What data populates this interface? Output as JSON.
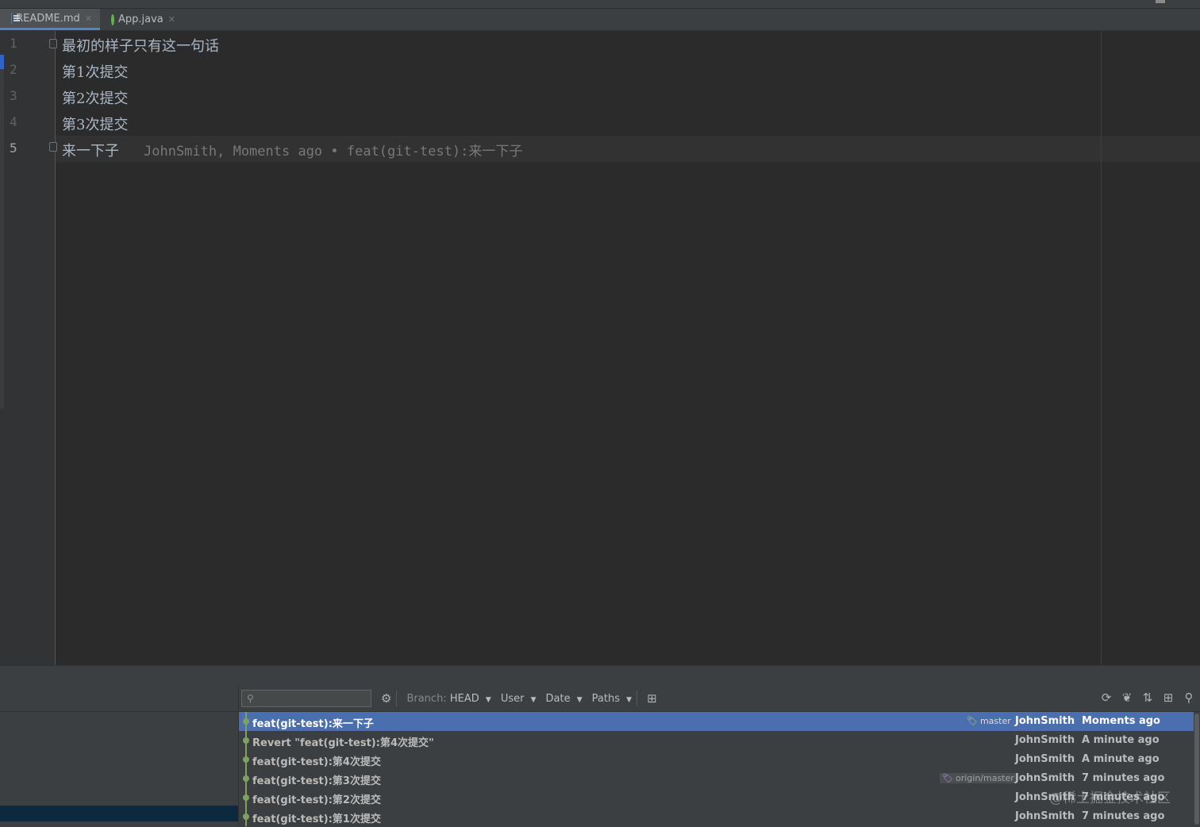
{
  "tabs": [
    {
      "label": "README.md",
      "icon": "markdown-file-icon"
    },
    {
      "label": "App.java",
      "icon": "java-file-icon"
    }
  ],
  "editor": {
    "line_numbers": [
      "1",
      "2",
      "3",
      "4",
      "5"
    ],
    "lines": [
      "最初的样子只有这一句话",
      "第1次提交",
      "第2次提交",
      "第3次提交",
      "来一下子"
    ],
    "blame": "JohnSmith, Moments ago • feat(git-test):来一下子"
  },
  "log_toolbar": {
    "search_placeholder": "",
    "branch_label": "Branch:",
    "branch_value": "HEAD",
    "user_label": "User",
    "date_label": "Date",
    "paths_label": "Paths"
  },
  "commits": [
    {
      "message": "feat(git-test):来一下子",
      "tag": "master",
      "author": "JohnSmith",
      "date": "Moments ago"
    },
    {
      "message": "Revert \"feat(git-test):第4次提交\"",
      "tag": "",
      "author": "JohnSmith",
      "date": "A minute ago"
    },
    {
      "message": "feat(git-test):第4次提交",
      "tag": "",
      "author": "JohnSmith",
      "date": "A minute ago"
    },
    {
      "message": "feat(git-test):第3次提交",
      "tag": "origin/master",
      "author": "JohnSmith",
      "date": "7 minutes ago"
    },
    {
      "message": "feat(git-test):第2次提交",
      "tag": "",
      "author": "JohnSmith",
      "date": "7 minutes ago"
    },
    {
      "message": "feat(git-test):第1次提交",
      "tag": "",
      "author": "JohnSmith",
      "date": "7 minutes ago"
    }
  ],
  "colors": {
    "selection": "#4b6eaf",
    "graph": "#7fa15e",
    "master_tag": "#d5c35a",
    "origin_tag": "#b39ddb"
  },
  "watermark": "@稀土掘金技术社区"
}
